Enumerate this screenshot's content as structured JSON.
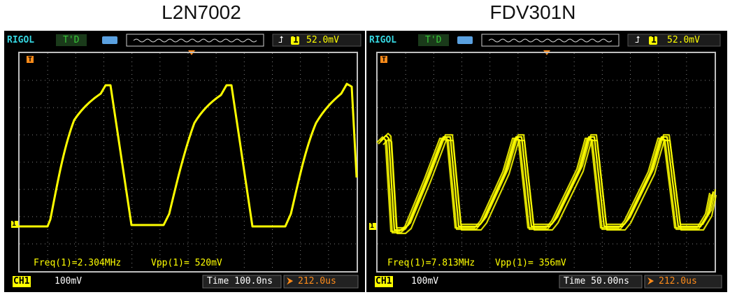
{
  "panels": [
    {
      "title": "L2N7002",
      "brand": "RIGOL",
      "run_status": "T'D",
      "trig_slope_icon": "rising-edge-icon",
      "trig_channel": "1",
      "trig_level": "52.0mV",
      "frequency": "Freq(1)=2.304MHz",
      "vpp": "Vpp(1)= 520mV",
      "channel": "CH1",
      "volts_div": "100mV",
      "time_div": "Time 100.0ns",
      "trig_offset": "212.0us",
      "ground_marker": "1",
      "trig_marker": "T"
    },
    {
      "title": "FDV301N",
      "brand": "RIGOL",
      "run_status": "T'D",
      "trig_slope_icon": "rising-edge-icon",
      "trig_channel": "1",
      "trig_level": "52.0mV",
      "frequency": "Freq(1)=7.813MHz",
      "vpp": "Vpp(1)= 356mV",
      "channel": "CH1",
      "volts_div": "100mV",
      "time_div": "Time 50.00ns",
      "trig_offset": "212.0us",
      "ground_marker": "1",
      "trig_marker": "T"
    }
  ],
  "colors": {
    "trace": "#ffff00",
    "grid": "#808080",
    "brand": "#35d6e0",
    "accent": "#ff8c1a"
  }
}
